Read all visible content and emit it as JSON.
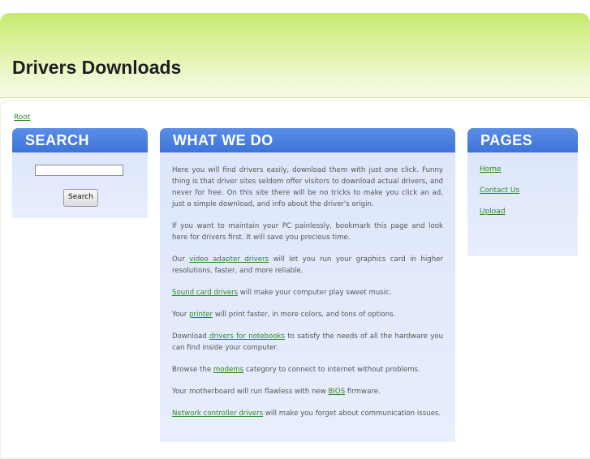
{
  "site": {
    "title": "Drivers Downloads"
  },
  "breadcrumb": "Root",
  "search": {
    "heading": "SEARCH",
    "input_value": "",
    "button_label": "Search"
  },
  "what": {
    "heading": "WHAT WE DO",
    "p1": "Here you will find drivers easily, download them with just one click. Funny thing is that driver sites seldom offer visitors to download actual drivers, and never for free. On this site there will be no tricks to make you click an ad, just a simple download, and info about the driver's origin.",
    "p2": "If you want to maintain your PC painlessly, bookmark this page and look here for drivers first. It will save you precious time.",
    "p3": {
      "a": "Our ",
      "link": "video adapter drivers",
      "b": " will let you run your graphics card in higher resolutions, faster, and more reliable."
    },
    "p4": {
      "link": "Sound card drivers",
      "b": " will make your computer play sweet music."
    },
    "p5": {
      "a": "Your ",
      "link": "printer",
      "b": " will print faster, in more colors, and tons of options."
    },
    "p6": {
      "a": "Download ",
      "link": "drivers for notebooks",
      "b": " to satisfy the needs of all the hardware you can find inside your computer."
    },
    "p7": {
      "a": "Browse the ",
      "link": "modems",
      "b": " category to connect to internet without problems."
    },
    "p8": {
      "a": "Your motherboard will run flawless with new ",
      "link": "BIOS",
      "b": " firmware."
    },
    "p9": {
      "link": "Network controller drivers",
      "b": " will make you forget about communication issues."
    }
  },
  "pages": {
    "heading": "PAGES",
    "links": [
      "Home",
      "Contact Us",
      "Upload"
    ]
  }
}
